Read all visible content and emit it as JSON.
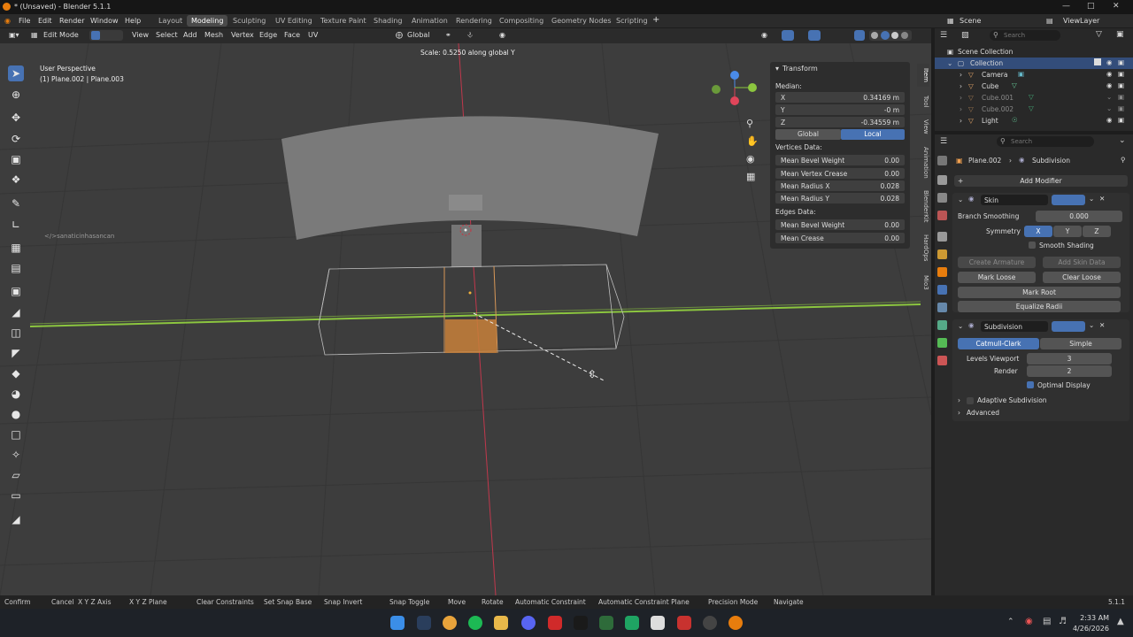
{
  "window": {
    "title": "* (Unsaved) - Blender 5.1.1"
  },
  "menu": [
    "File",
    "Edit",
    "Render",
    "Window",
    "Help"
  ],
  "workspaces": [
    "Layout",
    "Modeling",
    "Sculpting",
    "UV Editing",
    "Texture Paint",
    "Shading",
    "Animation",
    "Rendering",
    "Compositing",
    "Geometry Nodes",
    "Scripting"
  ],
  "active_workspace": "Modeling",
  "scene": {
    "label": "Scene",
    "view_layer": "ViewLayer"
  },
  "viewport_header": {
    "mode": "Edit Mode",
    "menus": [
      "View",
      "Select",
      "Add",
      "Mesh",
      "Vertex",
      "Edge",
      "Face",
      "UV"
    ],
    "orientation": "Global"
  },
  "viewport": {
    "perspective": "User Perspective",
    "objects": "(1) Plane.002 | Plane.003",
    "operator_info": "Scale: 0.5250 along global Y",
    "watermark": "</>sanaticinhasancan"
  },
  "npanel": {
    "title": "Transform",
    "median": "Median:",
    "x_label": "X",
    "x_val": "0.34169 m",
    "y_label": "Y",
    "y_val": "-0 m",
    "z_label": "Z",
    "z_val": "-0.34559 m",
    "global": "Global",
    "local": "Local",
    "vertices_data": "Vertices Data:",
    "mean_bevel_weight": "Mean Bevel Weight",
    "mbw_val": "0.00",
    "mean_vertex_crease": "Mean Vertex Crease",
    "mvc_val": "0.00",
    "mean_radius_x": "Mean Radius X",
    "mrx_val": "0.028",
    "mean_radius_y": "Mean Radius Y",
    "mry_val": "0.028",
    "edges_data": "Edges Data:",
    "edge_bevel": "Mean Bevel Weight",
    "eb_val": "0.00",
    "mean_crease": "Mean Crease",
    "mc_val": "0.00"
  },
  "npanel_tabs": [
    "Item",
    "Tool",
    "View",
    "Animation",
    "BlenderKit",
    "HardOps",
    "Mio3"
  ],
  "outliner": {
    "search_placeholder": "Search",
    "root": "Scene Collection",
    "collection": "Collection",
    "items": [
      "Camera",
      "Cube",
      "Cube.001",
      "Cube.002",
      "Light"
    ]
  },
  "properties": {
    "search_placeholder": "Search",
    "object": "Plane.002",
    "modifier_breadcrumb": "Subdivision",
    "add_modifier": "Add Modifier",
    "skin": {
      "name": "Skin",
      "branch_smoothing_label": "Branch Smoothing",
      "branch_smoothing": "0.000",
      "symmetry_label": "Symmetry",
      "sym_x": "X",
      "sym_y": "Y",
      "sym_z": "Z",
      "smooth_shading": "Smooth Shading",
      "create_armature": "Create Armature",
      "add_skin_data": "Add Skin Data",
      "mark_loose": "Mark Loose",
      "clear_loose": "Clear Loose",
      "mark_root": "Mark Root",
      "equalize_radii": "Equalize Radii"
    },
    "subdivision": {
      "name": "Subdivision",
      "catmull": "Catmull-Clark",
      "simple": "Simple",
      "levels_viewport_label": "Levels Viewport",
      "levels_viewport": "3",
      "render_label": "Render",
      "render": "2",
      "optimal_display": "Optimal Display",
      "adaptive": "Adaptive Subdivision",
      "advanced": "Advanced"
    }
  },
  "status": {
    "items": [
      "Confirm",
      "Cancel",
      "X Y Z Axis",
      "X Y Z Plane",
      "Clear Constraints",
      "Set Snap Base",
      "Snap Invert",
      "Snap Toggle",
      "Move",
      "Rotate",
      "Automatic Constraint",
      "Automatic Constraint Plane",
      "Precision Mode",
      "Navigate"
    ],
    "version": "5.1.1"
  },
  "taskbar": {
    "time": "2:33 AM",
    "date": "4/26/2026"
  },
  "colors": {
    "accent": "#4772b3",
    "selected_face": "#c8803a",
    "x_axis": "#e0455a",
    "y_axis": "#8cc63f",
    "z_axis": "#4a8be8"
  }
}
